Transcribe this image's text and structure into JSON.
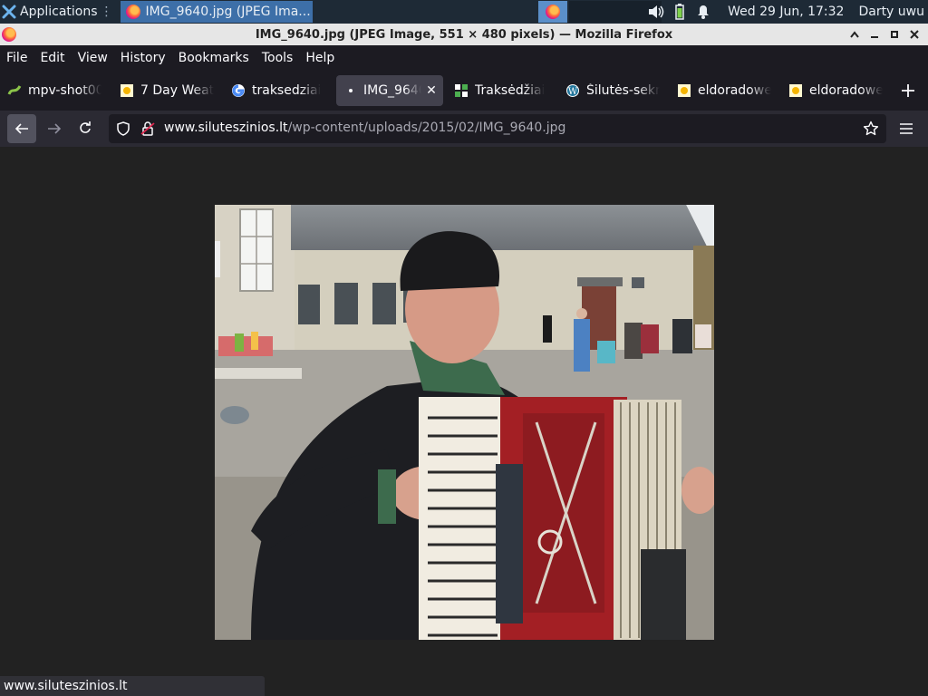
{
  "panel": {
    "applications_label": "Applications",
    "task_label": "IMG_9640.jpg (JPEG Ima...",
    "clock": "Wed 29 Jun, 17:32",
    "user": "Darty uwu",
    "icons": [
      "xfce-logo-icon",
      "firefox-icon",
      "volume-icon",
      "battery-icon",
      "bell-icon"
    ]
  },
  "window": {
    "title": "IMG_9640.jpg (JPEG Image, 551 × 480 pixels) — Mozilla Firefox",
    "controls": [
      "chevron-up-icon",
      "minimize-icon",
      "maximize-icon",
      "close-icon"
    ]
  },
  "menubar": {
    "items": [
      "File",
      "Edit",
      "View",
      "History",
      "Bookmarks",
      "Tools",
      "Help"
    ]
  },
  "tabs": [
    {
      "label": "mpv-shot00",
      "icon": "mpv-icon"
    },
    {
      "label": "7 Day Weat",
      "icon": "sun-icon"
    },
    {
      "label": "traksedziai",
      "icon": "google-icon"
    },
    {
      "label": "IMG_9640",
      "icon": "dot-icon",
      "active": true
    },
    {
      "label": "Traksėdžiai",
      "icon": "site-icon"
    },
    {
      "label": "Šilutės-sekr",
      "icon": "wordpress-icon"
    },
    {
      "label": "eldoradowe",
      "icon": "sun-icon"
    },
    {
      "label": "eldoradowe",
      "icon": "sun-icon"
    }
  ],
  "navbar": {
    "url_host": "www.siluteszinios.lt",
    "url_path": "/wp-content/uploads/2015/02/IMG_9640.jpg"
  },
  "status": {
    "text": "www.siluteszinios.lt"
  },
  "image": {
    "description_icon": "photo-accordion-player"
  }
}
